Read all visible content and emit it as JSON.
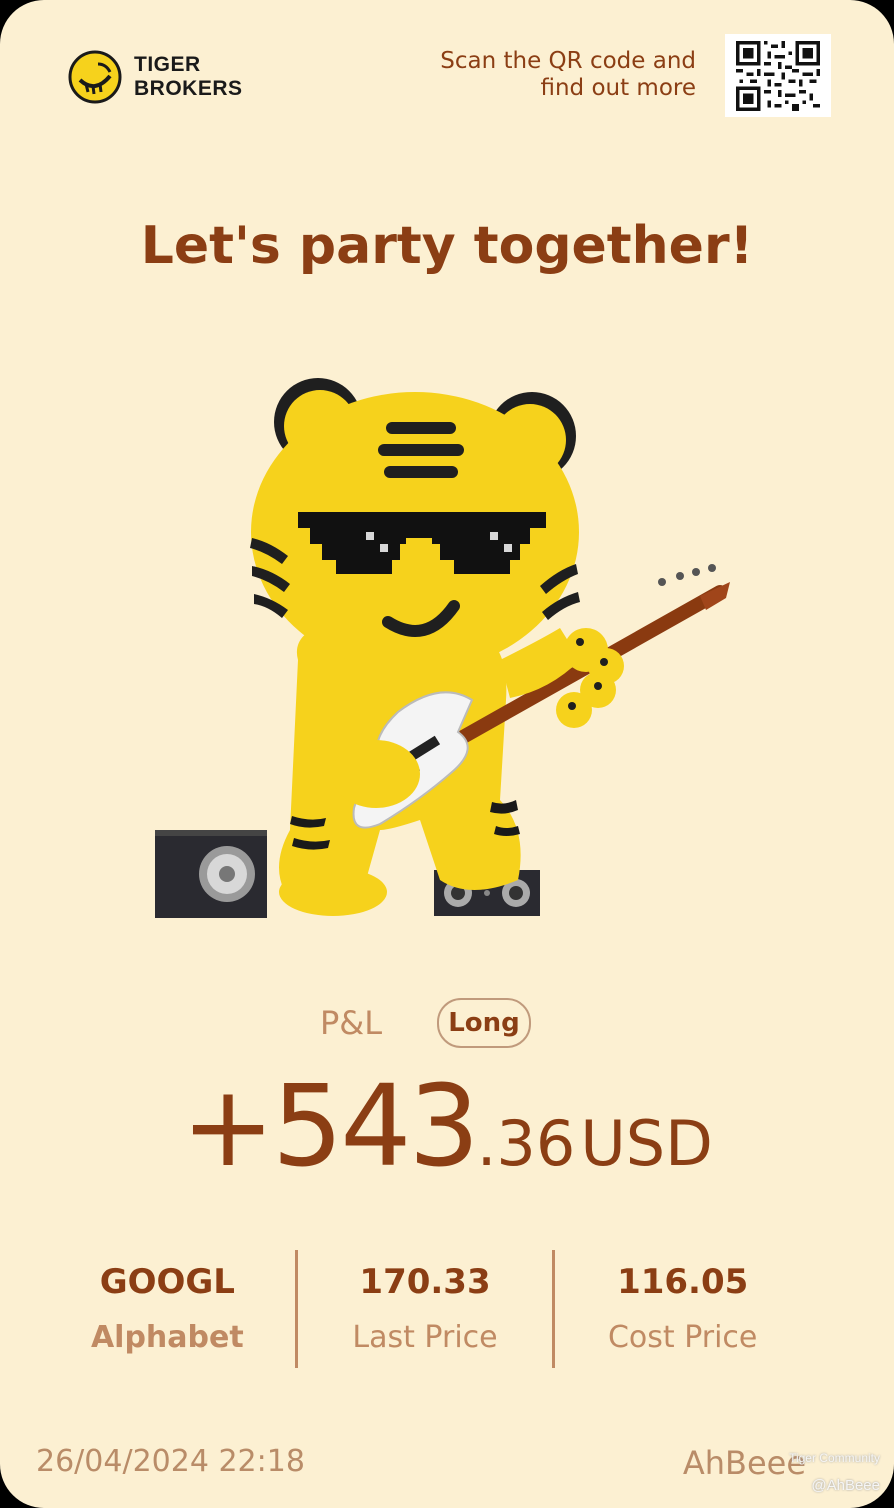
{
  "header": {
    "brand_line1": "TIGER",
    "brand_line2": "BROKERS",
    "scan_line1": "Scan the QR code and",
    "scan_line2": "find out more"
  },
  "headline": "Let's party together!",
  "pnl": {
    "label": "P&L",
    "direction_badge": "Long",
    "sign_and_integer": "+543",
    "decimals": ".36",
    "currency": "USD"
  },
  "stats": [
    {
      "value": "GOOGL",
      "label": "Alphabet"
    },
    {
      "value": "170.33",
      "label": "Last Price"
    },
    {
      "value": "116.05",
      "label": "Cost Price"
    }
  ],
  "footer": {
    "datetime": "26/04/2024 22:18",
    "username": "AhBeee"
  },
  "watermark": {
    "community": "Tiger Community",
    "handle": "@AhBeee"
  },
  "colors": {
    "background": "#fcf0d2",
    "primary_text": "#8b3e14",
    "muted_text": "#c08a63",
    "tiger_yellow": "#f6d21c"
  }
}
